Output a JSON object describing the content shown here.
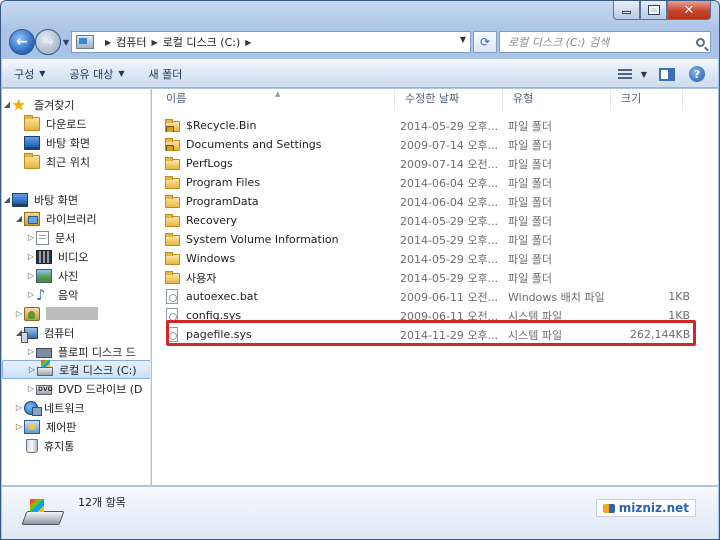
{
  "address": {
    "crumbs": [
      "컴퓨터",
      "로컬 디스크 (C:)"
    ],
    "search_placeholder": "로컬 디스크 (C:) 검색"
  },
  "toolbar": {
    "organize": "구성",
    "share": "공유 대상",
    "new_folder": "새 폴더"
  },
  "nav": {
    "favorites": "즐겨찾기",
    "downloads": "다운로드",
    "desktop_fav": "바탕 화면",
    "recent": "최근 위치",
    "desktop": "바탕 화면",
    "libraries": "라이브러리",
    "documents": "문서",
    "videos": "비디오",
    "pictures": "사진",
    "music": "음악",
    "computer": "컴퓨터",
    "floppy": "플로피 디스크 드",
    "local_disk": "로컬 디스크 (C:)",
    "dvd": "DVD 드라이브 (D",
    "network": "네트워크",
    "control_panel": "제어판",
    "recycle_bin": "휴지통"
  },
  "columns": {
    "name": "이름",
    "date": "수정한 날짜",
    "type": "유형",
    "size": "크기"
  },
  "files": [
    {
      "name": "$Recycle.Bin",
      "date": "2014-05-29 오후...",
      "type": "파일 폴더",
      "size": "",
      "icon": "locked-folder-icon"
    },
    {
      "name": "Documents and Settings",
      "date": "2009-07-14 오후...",
      "type": "파일 폴더",
      "size": "",
      "icon": "locked-folder-icon"
    },
    {
      "name": "PerfLogs",
      "date": "2009-07-14 오전...",
      "type": "파일 폴더",
      "size": "",
      "icon": "folder-icon"
    },
    {
      "name": "Program Files",
      "date": "2014-06-04 오후...",
      "type": "파일 폴더",
      "size": "",
      "icon": "folder-icon"
    },
    {
      "name": "ProgramData",
      "date": "2014-06-04 오후...",
      "type": "파일 폴더",
      "size": "",
      "icon": "folder-icon"
    },
    {
      "name": "Recovery",
      "date": "2014-05-29 오후...",
      "type": "파일 폴더",
      "size": "",
      "icon": "folder-icon"
    },
    {
      "name": "System Volume Information",
      "date": "2014-05-29 오후...",
      "type": "파일 폴더",
      "size": "",
      "icon": "folder-icon"
    },
    {
      "name": "Windows",
      "date": "2014-05-29 오후...",
      "type": "파일 폴더",
      "size": "",
      "icon": "folder-icon"
    },
    {
      "name": "사용자",
      "date": "2014-05-29 오후...",
      "type": "파일 폴더",
      "size": "",
      "icon": "folder-icon"
    },
    {
      "name": "autoexec.bat",
      "date": "2009-06-11 오전...",
      "type": "Windows 배치 파일",
      "size": "1KB",
      "icon": "batch-file-icon"
    },
    {
      "name": "config.sys",
      "date": "2009-06-11 오전...",
      "type": "시스템 파일",
      "size": "1KB",
      "icon": "system-file-icon"
    },
    {
      "name": "pagefile.sys",
      "date": "2014-11-29 오후...",
      "type": "시스템 파일",
      "size": "262,144KB",
      "icon": "system-file-icon"
    }
  ],
  "details": {
    "item_count": "12개 항목"
  },
  "watermark": "mizniz.net",
  "colors": {
    "highlight": "#d02828",
    "accent": "#2c63b5"
  }
}
